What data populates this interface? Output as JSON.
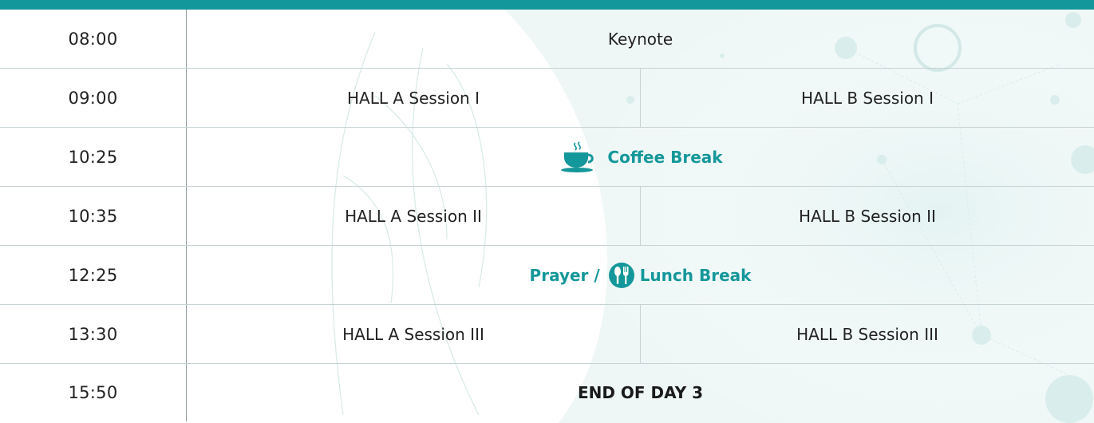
{
  "colors": {
    "accent": "#14979a",
    "text": "#222222",
    "divider": "#c7d2d4"
  },
  "schedule": [
    {
      "time": "08:00",
      "type": "full",
      "label": "Keynote"
    },
    {
      "time": "09:00",
      "type": "split",
      "hall_a": "HALL A Session I",
      "hall_b": "HALL B Session I"
    },
    {
      "time": "10:25",
      "type": "break",
      "label": "Coffee Break",
      "icon": "coffee-cup-icon"
    },
    {
      "time": "10:35",
      "type": "split",
      "hall_a": "HALL A Session II",
      "hall_b": "HALL B Session II"
    },
    {
      "time": "12:25",
      "type": "break",
      "label_prefix": "Prayer /",
      "label": "Lunch Break",
      "icon": "fork-spoon-icon"
    },
    {
      "time": "13:30",
      "type": "split",
      "hall_a": "HALL A Session III",
      "hall_b": "HALL B Session III"
    },
    {
      "time": "15:50",
      "type": "end",
      "label": "END OF DAY 3"
    }
  ]
}
